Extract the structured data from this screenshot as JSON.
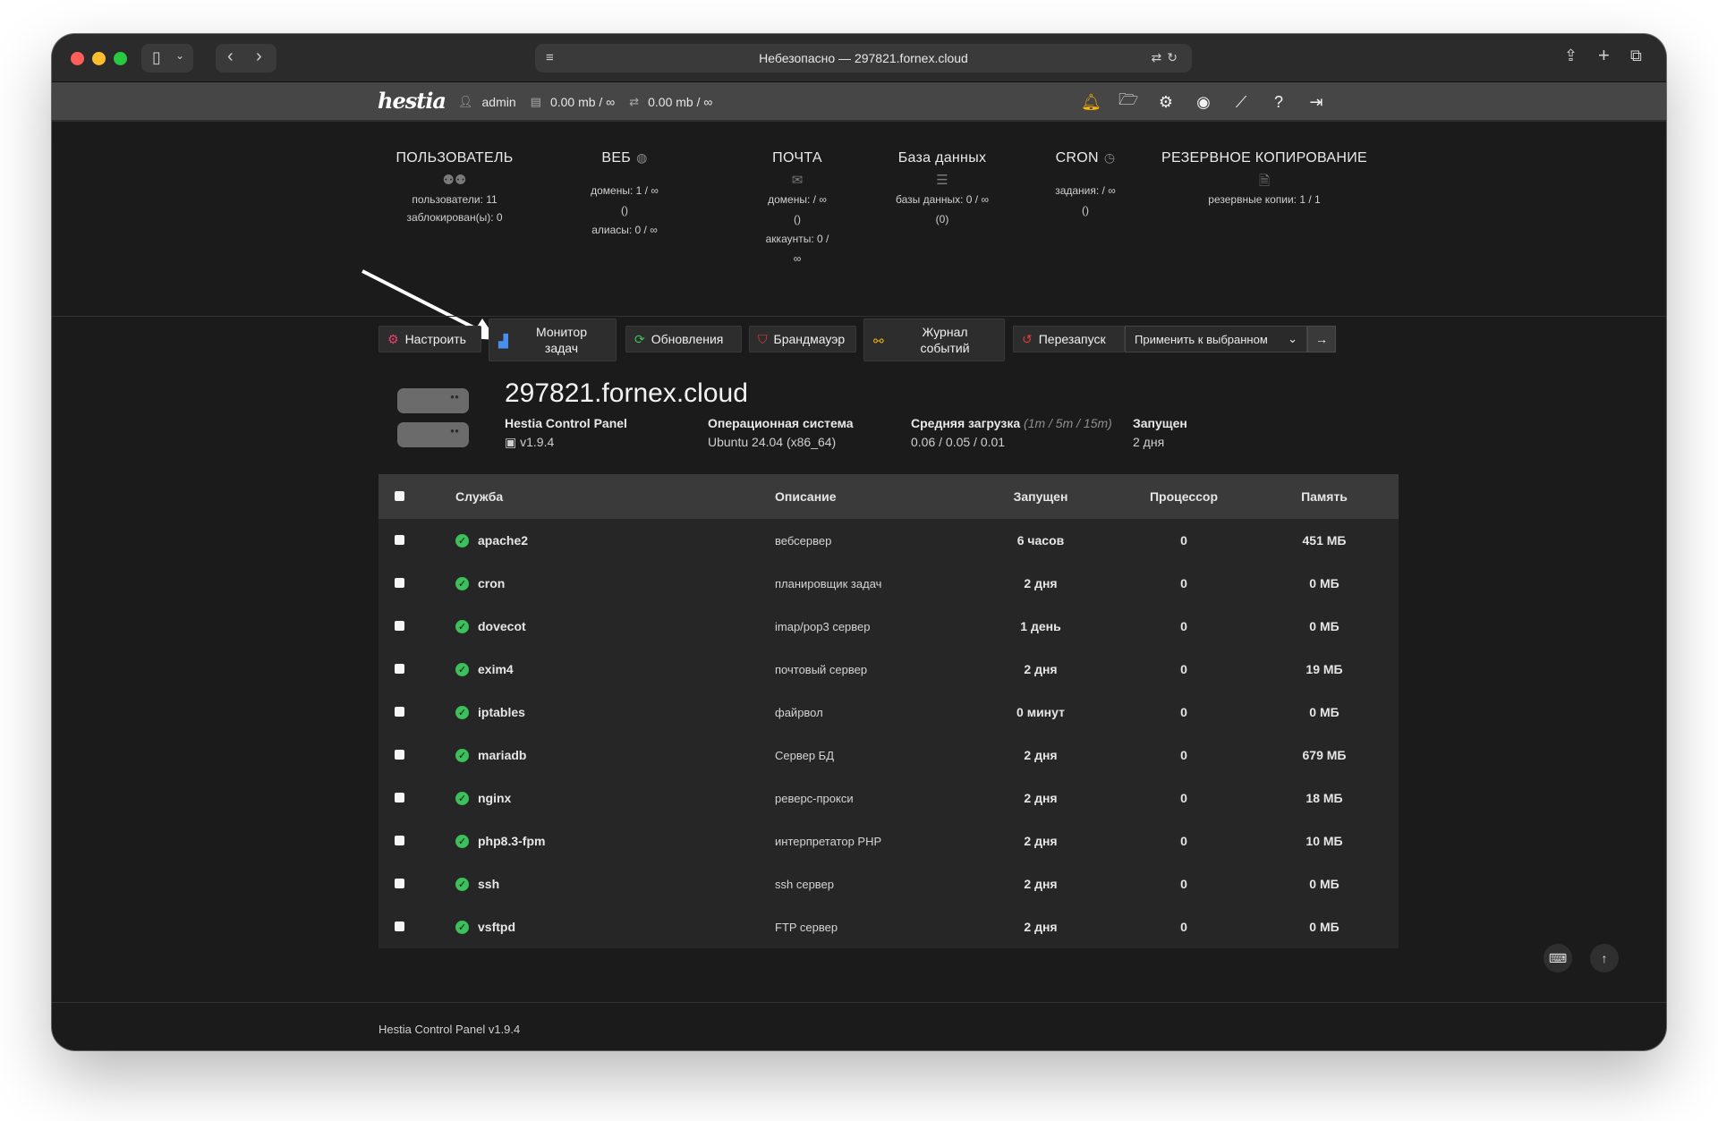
{
  "browser": {
    "address": "Небезопасно — 297821.fornex.cloud"
  },
  "nav": {
    "logo": "hestia",
    "user": "admin",
    "disk": "0.00 mb / ∞",
    "bandwidth": "0.00 mb / ∞"
  },
  "stats": {
    "user": {
      "title": "ПОЛЬЗОВАТЕЛЬ",
      "line1": "пользователи: 11",
      "line2": "заблокирован(ы): 0"
    },
    "web": {
      "title": "ВЕБ",
      "line1": "домены: 1 / ∞",
      "line2": "()",
      "line3": "алиасы: 0 / ∞"
    },
    "mail": {
      "title": "ПОЧТА",
      "line1": "домены: / ∞",
      "line2": "()",
      "line3": "аккаунты: 0 /",
      "line4": "∞"
    },
    "db": {
      "title": "База данных",
      "line1": "базы данных: 0 / ∞",
      "line2": "(0)"
    },
    "cron": {
      "title": "CRON",
      "line1": "задания: / ∞",
      "line2": "()"
    },
    "backup": {
      "title": "РЕЗЕРВНОЕ КОПИРОВАНИЕ",
      "line1": "резервные копии: 1 / 1"
    }
  },
  "toolbar": {
    "configure": "Настроить",
    "task_monitor_1": "Монитор",
    "task_monitor_2": "задач",
    "updates": "Обновления",
    "firewall": "Брандмауэр",
    "event_log_1": "Журнал",
    "event_log_2": "событий",
    "restart": "Перезапуск",
    "apply_select": "Применить к выбранном"
  },
  "server": {
    "hostname": "297821.fornex.cloud",
    "panel_label": "Hestia Control Panel",
    "panel_version": "v1.9.4",
    "os_label": "Операционная система",
    "os_value": "Ubuntu 24.04 (x86_64)",
    "load_label": "Средняя загрузка",
    "load_hint": "(1m / 5m / 15m)",
    "load_value": "0.06 / 0.05 / 0.01",
    "uptime_label": "Запущен",
    "uptime_value": "2 дня"
  },
  "table": {
    "headers": {
      "service": "Служба",
      "description": "Описание",
      "uptime": "Запущен",
      "cpu": "Процессор",
      "memory": "Память"
    },
    "rows": [
      {
        "name": "apache2",
        "desc": "вебсервер",
        "uptime": "6 часов",
        "cpu": "0",
        "mem": "451 МБ"
      },
      {
        "name": "cron",
        "desc": "планировщик задач",
        "uptime": "2 дня",
        "cpu": "0",
        "mem": "0 МБ"
      },
      {
        "name": "dovecot",
        "desc": "imap/pop3 сервер",
        "uptime": "1 день",
        "cpu": "0",
        "mem": "0 МБ"
      },
      {
        "name": "exim4",
        "desc": "почтовый сервер",
        "uptime": "2 дня",
        "cpu": "0",
        "mem": "19 МБ"
      },
      {
        "name": "iptables",
        "desc": "файрвол",
        "uptime": "0 минут",
        "cpu": "0",
        "mem": "0 МБ"
      },
      {
        "name": "mariadb",
        "desc": "Сервер БД",
        "uptime": "2 дня",
        "cpu": "0",
        "mem": "679 МБ"
      },
      {
        "name": "nginx",
        "desc": "реверс-прокси",
        "uptime": "2 дня",
        "cpu": "0",
        "mem": "18 МБ"
      },
      {
        "name": "php8.3-fpm",
        "desc": "интерпретатор PHP",
        "uptime": "2 дня",
        "cpu": "0",
        "mem": "10 МБ"
      },
      {
        "name": "ssh",
        "desc": "ssh сервер",
        "uptime": "2 дня",
        "cpu": "0",
        "mem": "0 МБ"
      },
      {
        "name": "vsftpd",
        "desc": "FTP сервер",
        "uptime": "2 дня",
        "cpu": "0",
        "mem": "0 МБ"
      }
    ]
  },
  "footer": {
    "text": "Hestia Control Panel v1.9.4"
  }
}
